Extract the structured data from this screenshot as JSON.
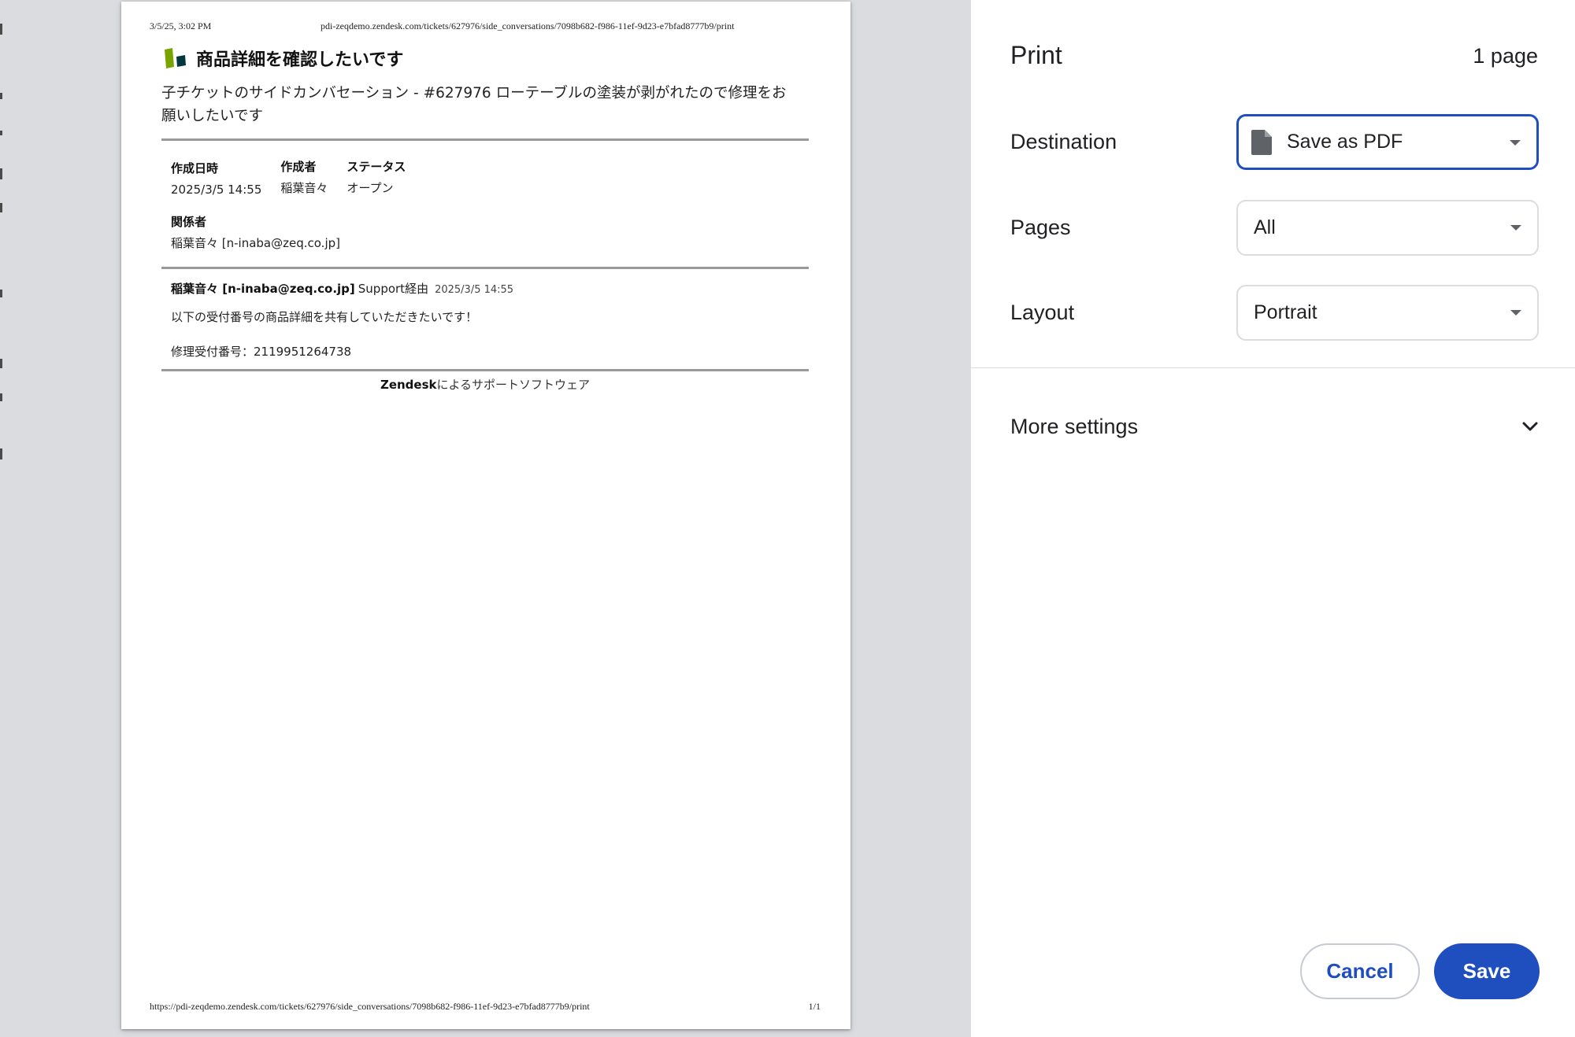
{
  "preview": {
    "page_header": {
      "datetime": "3/5/25, 3:02 PM",
      "url": "pdi-zeqdemo.zendesk.com/tickets/627976/side_conversations/7098b682-f986-11ef-9d23-e7bfad8777b9/print"
    },
    "page_footer": {
      "url": "https://pdi-zeqdemo.zendesk.com/tickets/627976/side_conversations/7098b682-f986-11ef-9d23-e7bfad8777b9/print",
      "page_number": "1/1"
    },
    "document": {
      "title": "商品詳細を確認したいです",
      "subtitle_line1": "子チケットのサイドカンバセーション - #627976 ローテーブルの塗装が剥がれたので修理をお",
      "subtitle_line2": "願いしたいです",
      "meta": {
        "created_label": "作成日時",
        "created_value": "2025/3/5 14:55",
        "author_label": "作成者",
        "author_value": "稲葉音々",
        "status_label": "ステータス",
        "status_value": "オープン",
        "cc_label": "関係者",
        "cc_value": "稲葉音々 [n-inaba@zeq.co.jp]"
      },
      "message": {
        "author": "稲葉音々 [n-inaba@zeq.co.jp]",
        "via": "Support経由",
        "time": "2025/3/5 14:55",
        "body_line1": "以下の受付番号の商品詳細を共有していただきたいです！",
        "body_line2": "修理受付番号：2119951264738"
      },
      "powered_by": {
        "brand": "Zendesk",
        "text": "によるサポートソフトウェア"
      }
    }
  },
  "panel": {
    "title": "Print",
    "page_count": "1 page",
    "destination": {
      "label": "Destination",
      "value": "Save as PDF",
      "icon": "document-icon"
    },
    "pages": {
      "label": "Pages",
      "value": "All"
    },
    "layout": {
      "label": "Layout",
      "value": "Portrait"
    },
    "more_settings": {
      "label": "More settings",
      "icon": "chevron-down-icon"
    },
    "buttons": {
      "cancel": "Cancel",
      "save": "Save"
    }
  },
  "colors": {
    "accent": "#1f4fbf",
    "preview_background": "#dadce0",
    "logo_green": "#78a300",
    "logo_dark": "#03363d"
  }
}
